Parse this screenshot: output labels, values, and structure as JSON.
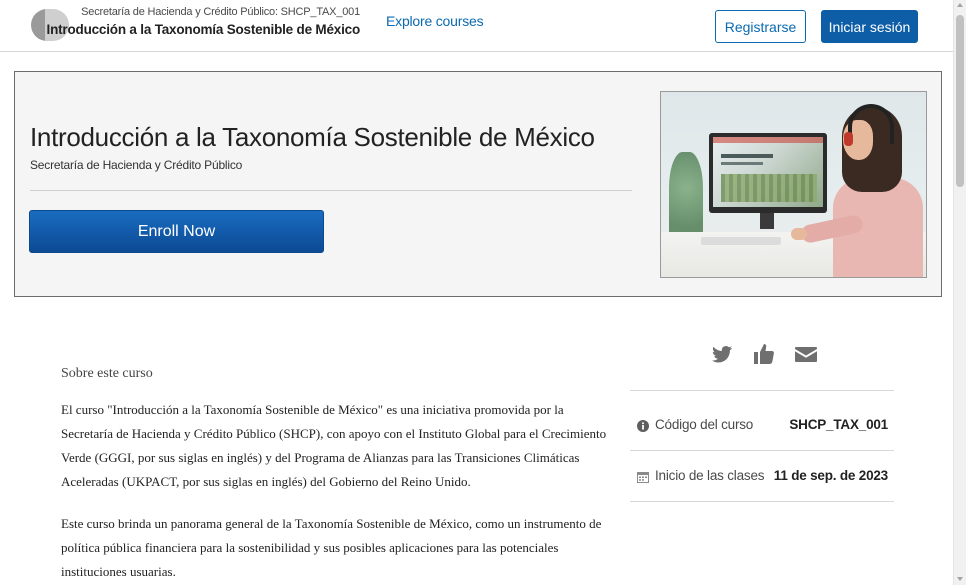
{
  "header": {
    "course_org": "Secretaría de Hacienda y Crédito Público: SHCP_TAX_001",
    "course_name": "Introducción a la Taxonomía Sostenible de México",
    "explore_link": "Explore courses",
    "register_label": "Registrarse",
    "login_label": "Iniciar sesión"
  },
  "hero": {
    "title": "Introducción a la Taxonomía Sostenible de México",
    "organization": "Secretaría de Hacienda y Crédito Público",
    "enroll_label": "Enroll Now",
    "image_icon": "course-hero-image"
  },
  "share": {
    "icons": [
      "twitter-icon",
      "like-icon",
      "email-icon"
    ]
  },
  "about": {
    "heading": "Sobre este curso",
    "paragraphs": [
      "El curso \"Introducción a la Taxonomía Sostenible de México\" es una iniciativa promovida por la Secretaría de Hacienda y Crédito Público (SHCP), con apoyo con el Instituto Global para el Crecimiento Verde (GGGI, por sus siglas en inglés) y del Programa de Alianzas para las Transiciones Climáticas Aceleradas (UKPACT, por sus siglas en inglés) del Gobierno del Reino Unido.",
      "Este curso brinda un panorama general de la Taxonomía Sostenible de México, como un instrumento de política pública financiera para la sostenibilidad y sus posibles aplicaciones para las potenciales instituciones usuarias."
    ]
  },
  "info": {
    "rows": [
      {
        "icon": "info-icon",
        "label": "Código del curso",
        "value": "SHCP_TAX_001"
      },
      {
        "icon": "calendar-icon",
        "label": "Inicio de las clases",
        "value": "11 de sep. de 2023"
      }
    ]
  },
  "colors": {
    "link": "#0b6ab0",
    "primary_button": "#0d5ea7",
    "enroll_button": "#0c4a94",
    "icon_gray": "#6f6f6f"
  }
}
